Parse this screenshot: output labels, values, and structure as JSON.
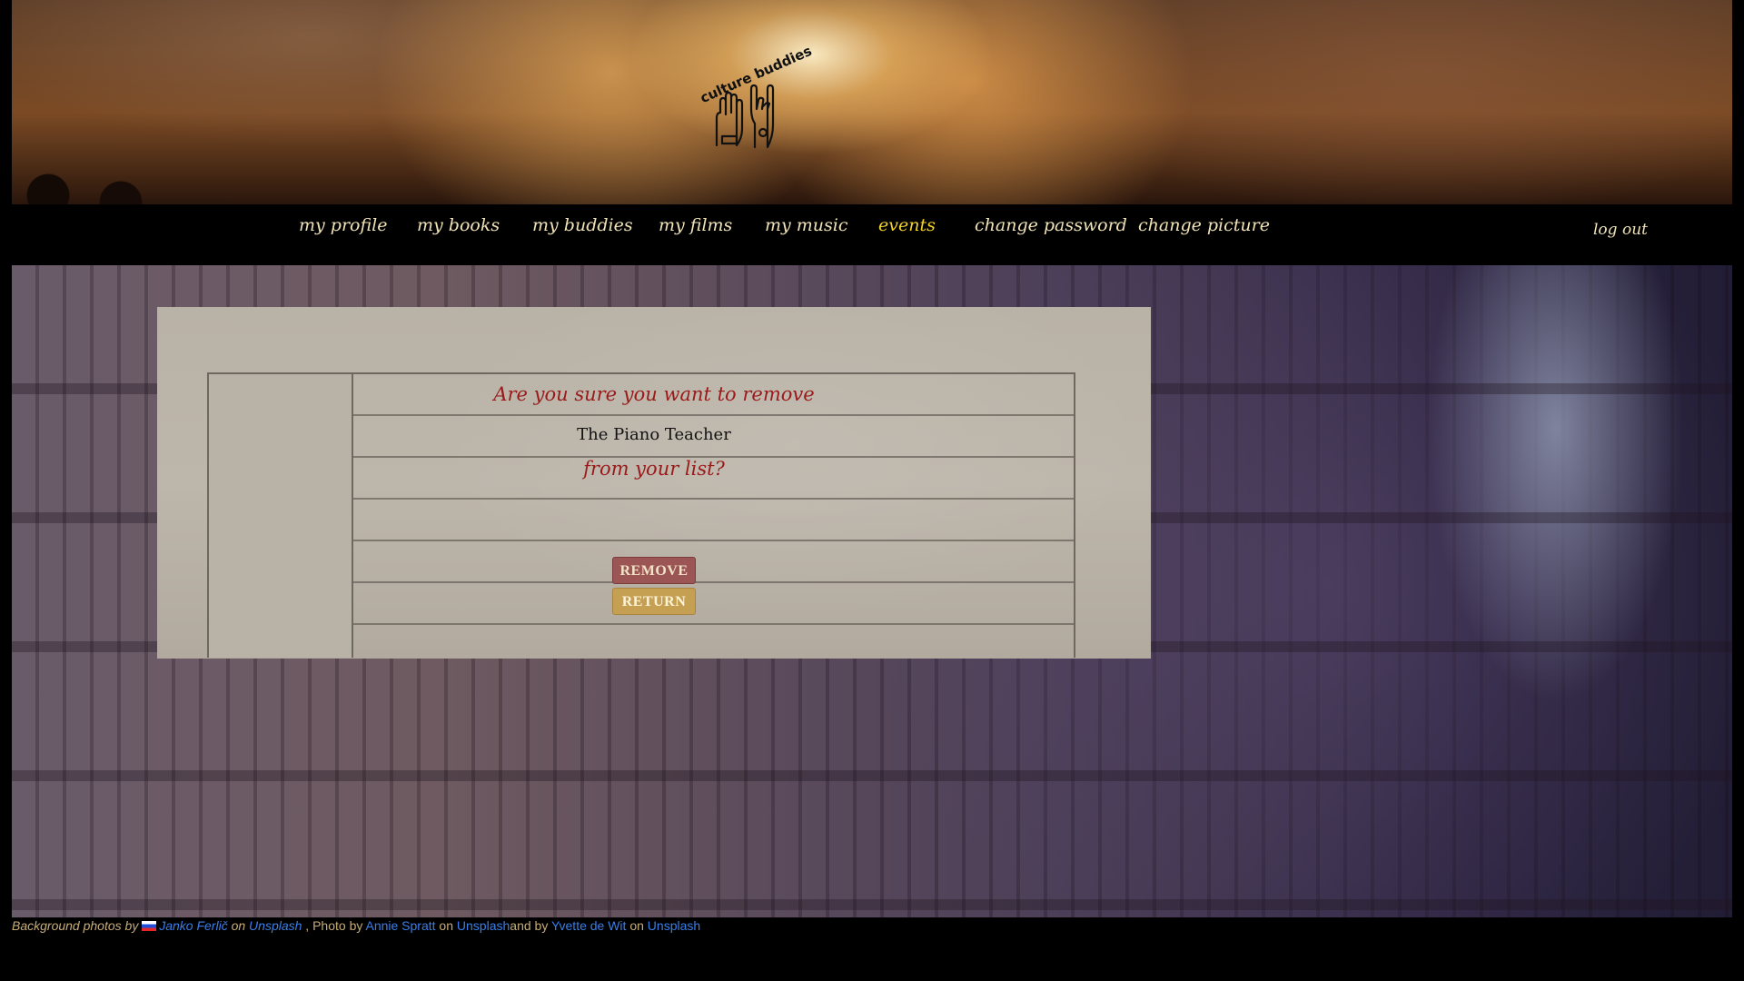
{
  "header": {
    "logo_text": "culture buddies"
  },
  "nav": {
    "items": [
      {
        "label": "my profile",
        "active": false
      },
      {
        "label": "my books",
        "active": false
      },
      {
        "label": "my buddies",
        "active": false
      },
      {
        "label": "my films",
        "active": false
      },
      {
        "label": "my music",
        "active": false
      },
      {
        "label": "events",
        "active": true
      },
      {
        "label": "change password",
        "active": false
      },
      {
        "label": "change picture",
        "active": false
      }
    ],
    "logout": "log out"
  },
  "dialog": {
    "question": "Are you sure you want to remove",
    "item_title": "The Piano Teacher",
    "question_end": "from your list?",
    "remove_label": "REMOVE",
    "return_label": "RETURN"
  },
  "credits": {
    "prefix": "Background photos by ",
    "photographer1": "Janko Ferlič",
    "on1": " on ",
    "site1": "Unsplash",
    "sep": " , Photo by ",
    "photographer2": "Annie Spratt",
    "on2": " on ",
    "site2": "Unsplash",
    "and": "and by ",
    "photographer3": "Yvette de Wit",
    "on3": " on ",
    "site3": "Unsplash"
  },
  "colors": {
    "nav_text": "#f0e3b8",
    "nav_active": "#f3d22a",
    "dialog_heading": "#9a1a1a",
    "remove_button": "#9b5555",
    "return_button": "#c5a052",
    "link": "#3a7ee8"
  }
}
